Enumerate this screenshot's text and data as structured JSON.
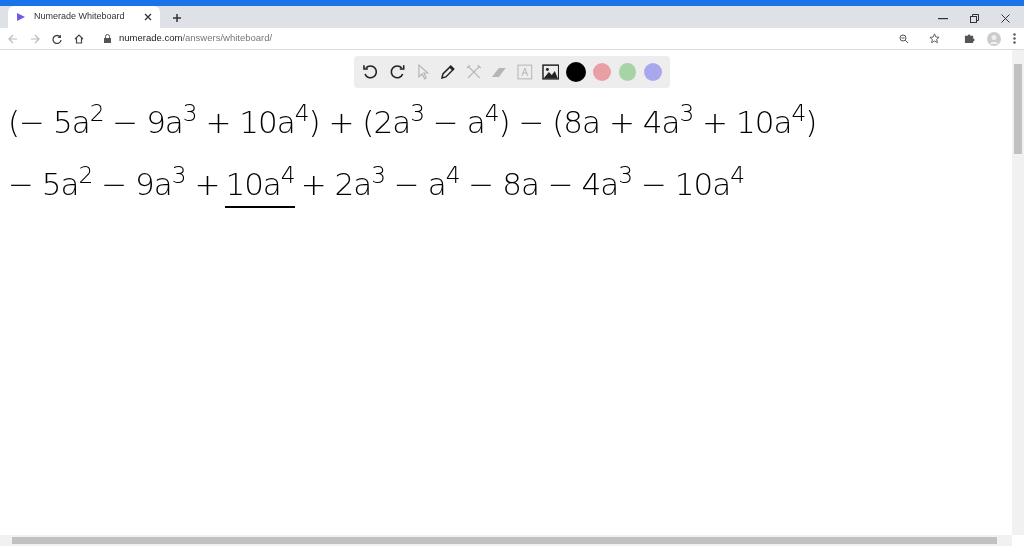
{
  "browser": {
    "tab_title": "Numerade Whiteboard",
    "url_host": "numerade.com",
    "url_path": "/answers/whiteboard/"
  },
  "toolbar": {
    "tools": [
      {
        "kind": "undo",
        "disabled": false
      },
      {
        "kind": "redo",
        "disabled": false
      },
      {
        "kind": "select",
        "disabled": true
      },
      {
        "kind": "pen",
        "disabled": false
      },
      {
        "kind": "shapes",
        "disabled": true
      },
      {
        "kind": "eraser",
        "disabled": true
      },
      {
        "kind": "text",
        "disabled": true
      },
      {
        "kind": "image",
        "disabled": false
      }
    ],
    "colors": [
      {
        "color": "#000000",
        "selected": true
      },
      {
        "color": "#e8a0a4",
        "selected": false
      },
      {
        "color": "#a6d4a6",
        "selected": false
      },
      {
        "color": "#aaa8ec",
        "selected": false
      }
    ]
  },
  "board": {
    "lines": [
      {
        "segments": [
          {
            "text": "(− 5a$^{2}$ − 9a$^{3}$ + 10a$^{4}$) + (2a$^{3}$ − a$^{4}$) − (8a + 4a$^{3}$ + 10a$^{4}$)",
            "underlined": false
          }
        ]
      },
      {
        "segments": [
          {
            "text": "− 5a$^{2}$ − 9a$^{3}$ +",
            "underlined": false
          },
          {
            "text": "10a$^{4}$",
            "underlined": true
          },
          {
            "text": "+ 2a$^{3}$ − a$^{4}$ − 8a − 4a$^{3}$ − 10a$^{4}$",
            "underlined": false
          }
        ]
      }
    ]
  }
}
